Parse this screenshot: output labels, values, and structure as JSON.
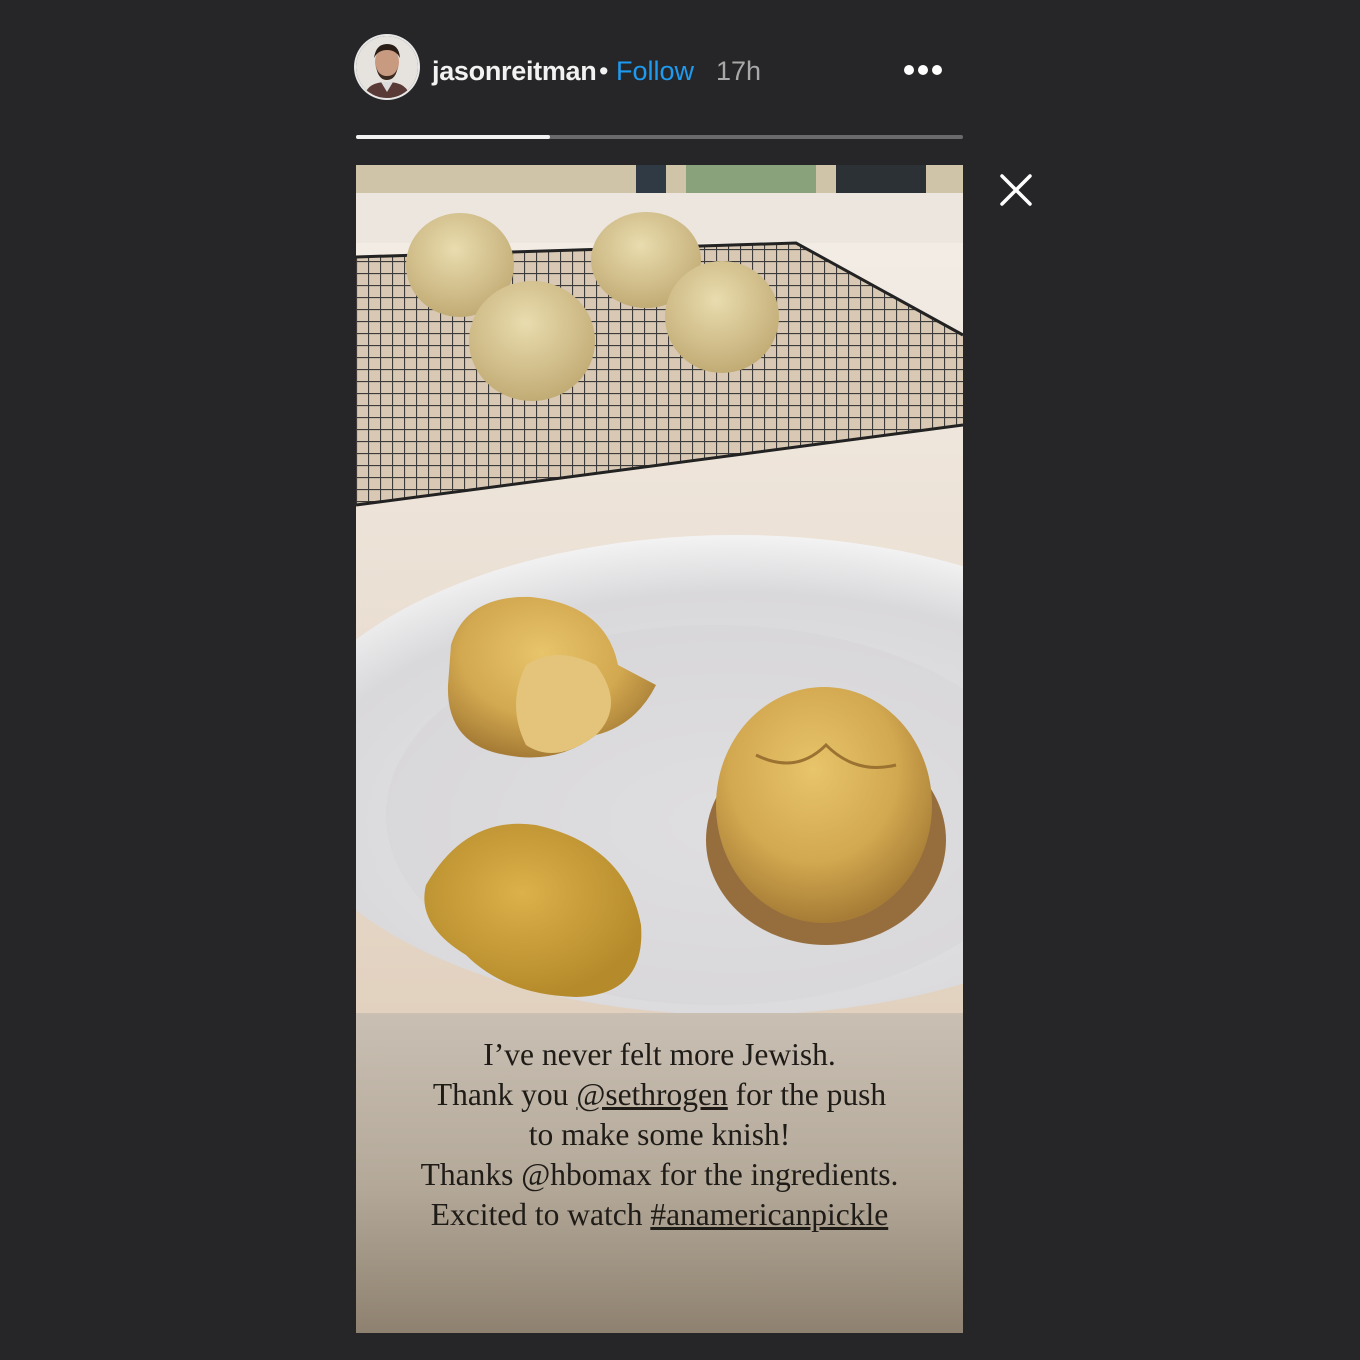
{
  "header": {
    "username": "jasonreitman",
    "separator": "•",
    "follow_label": "Follow",
    "time_ago": "17h",
    "more_icon": "more-horizontal-icon"
  },
  "progress": {
    "segments": 1,
    "current_fraction": 0.32
  },
  "close_icon": "close-icon",
  "caption": {
    "line1": "I’ve never felt more Jewish.",
    "line2_pre": "Thank you ",
    "line2_mention": "@sethrogen",
    "line2_post": " for the push",
    "line3": "to make some knish!",
    "line4": "Thanks @hbomax for the ingredients.",
    "line5_pre": "Excited to watch ",
    "line5_hashtag": "#anamericanpickle"
  },
  "colors": {
    "background": "#262628",
    "follow": "#1e9bf0",
    "progress_active": "#f2f2f2",
    "progress_track": "#6a6a6c"
  }
}
